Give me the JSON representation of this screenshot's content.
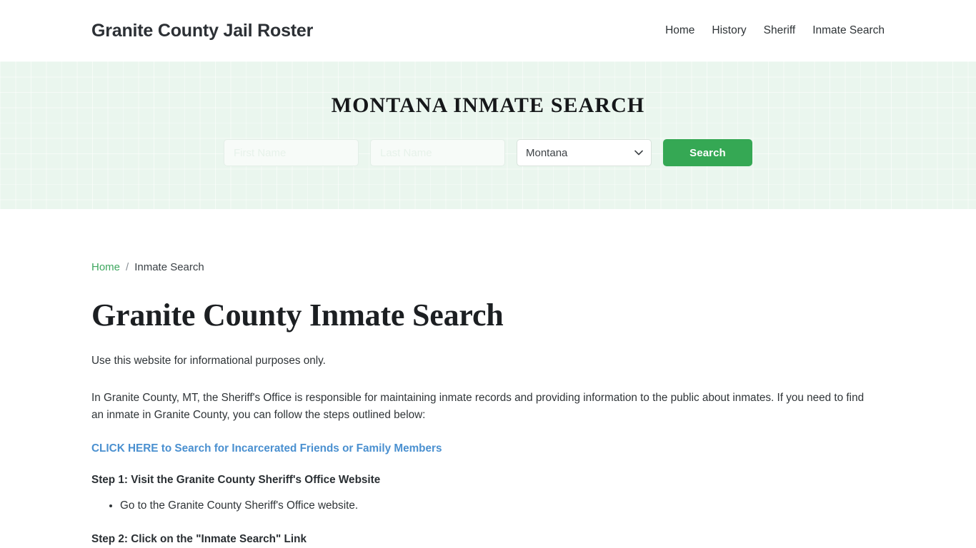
{
  "header": {
    "brand": "Granite County Jail Roster",
    "nav": [
      {
        "label": "Home"
      },
      {
        "label": "History"
      },
      {
        "label": "Sheriff"
      },
      {
        "label": "Inmate Search"
      }
    ]
  },
  "hero": {
    "title": "MONTANA INMATE SEARCH",
    "first_name_placeholder": "First Name",
    "first_name_value": "",
    "last_name_placeholder": "Last Name",
    "last_name_value": "",
    "state_selected": "Montana",
    "state_options": [
      "Montana"
    ],
    "search_button": "Search",
    "accent_green": "#35a854",
    "background_color": "#eaf6ee"
  },
  "breadcrumb": {
    "home": "Home",
    "separator": "/",
    "current": "Inmate Search"
  },
  "main": {
    "page_title": "Granite County Inmate Search",
    "intro": "Use this website for informational purposes only.",
    "paragraph": "In Granite County, MT, the Sheriff's Office is responsible for maintaining inmate records and providing information to the public about inmates. If you need to find an inmate in Granite County, you can follow the steps outlined below:",
    "cta_link": "CLICK HERE to Search for Incarcerated Friends or Family Members",
    "step1_heading": "Step 1: Visit the Granite County Sheriff's Office Website",
    "step1_items": [
      "Go to the Granite County Sheriff's Office website."
    ],
    "step2_heading": "Step 2: Click on the \"Inmate Search\" Link"
  }
}
